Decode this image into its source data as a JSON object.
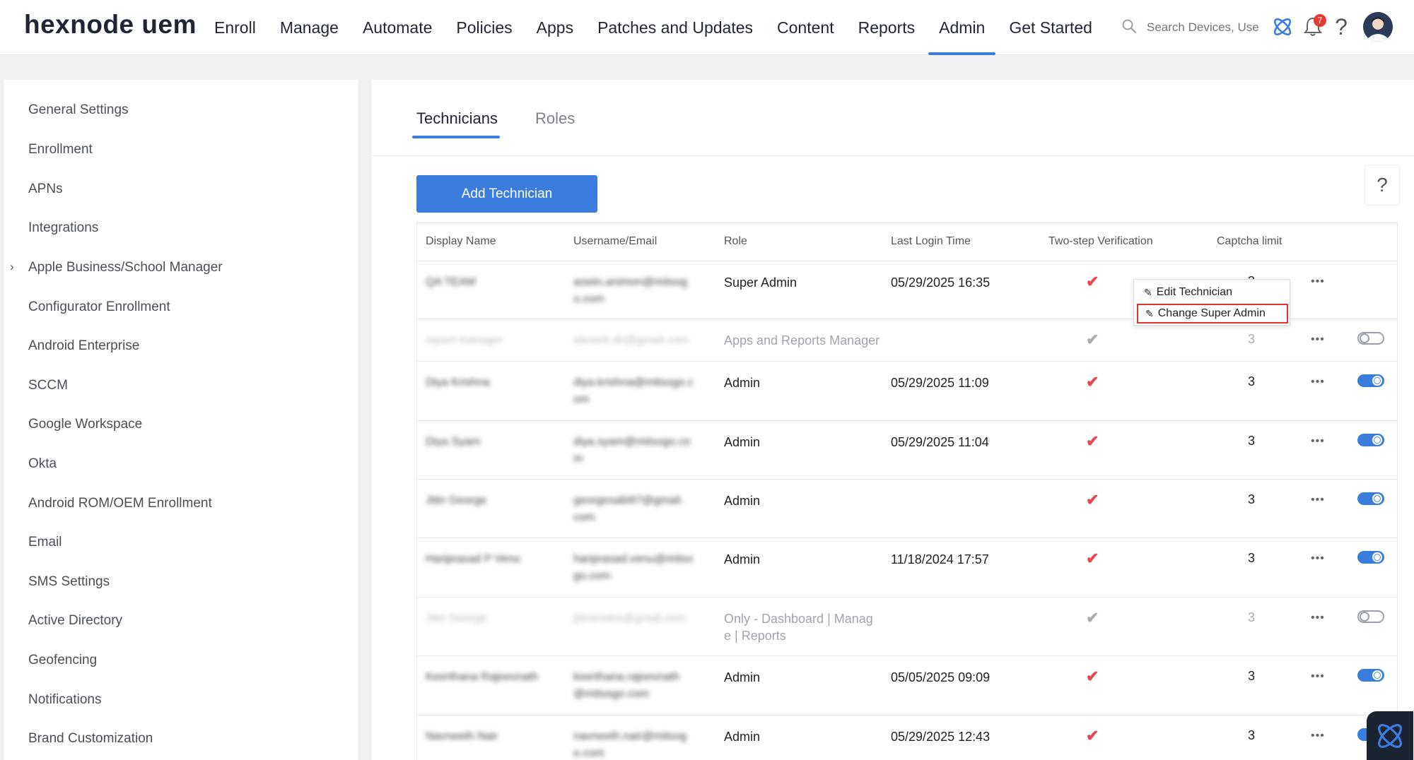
{
  "brand": {
    "logo_text": "hexnode uem",
    "accent": "#3b7ddd",
    "check_color": "#e5484d"
  },
  "nav": {
    "items": [
      {
        "label": "Enroll"
      },
      {
        "label": "Manage"
      },
      {
        "label": "Automate"
      },
      {
        "label": "Policies"
      },
      {
        "label": "Apps"
      },
      {
        "label": "Patches and Updates"
      },
      {
        "label": "Content"
      },
      {
        "label": "Reports"
      },
      {
        "label": "Admin"
      },
      {
        "label": "Get Started"
      }
    ],
    "active": "Admin"
  },
  "topbar": {
    "search_placeholder": "Search Devices, Use",
    "notification_count": "7",
    "help_icon": "?"
  },
  "sidebar": {
    "items": [
      {
        "label": "General Settings"
      },
      {
        "label": "Enrollment"
      },
      {
        "label": "APNs"
      },
      {
        "label": "Integrations"
      },
      {
        "label": "Apple Business/School Manager",
        "expandable": true
      },
      {
        "label": "Configurator Enrollment"
      },
      {
        "label": "Android Enterprise"
      },
      {
        "label": "SCCM"
      },
      {
        "label": "Google Workspace"
      },
      {
        "label": "Okta"
      },
      {
        "label": "Android ROM/OEM Enrollment"
      },
      {
        "label": "Email"
      },
      {
        "label": "SMS Settings"
      },
      {
        "label": "Active Directory"
      },
      {
        "label": "Geofencing"
      },
      {
        "label": "Notifications"
      },
      {
        "label": "Brand Customization"
      }
    ]
  },
  "main": {
    "tabs": [
      {
        "label": "Technicians"
      },
      {
        "label": "Roles"
      }
    ],
    "active_tab": "Technicians",
    "add_button": "Add Technician",
    "help_label": "?",
    "table": {
      "headers": [
        "Display Name",
        "Username/Email",
        "Role",
        "Last Login Time",
        "Two-step Verification",
        "Captcha limit"
      ],
      "rows": [
        {
          "name": "QA TEAM",
          "email": [
            "aswin.animon@mitsog",
            "o.com"
          ],
          "role": "Super Admin",
          "last_login": "05/29/2025 16:35",
          "two_step": true,
          "captcha": "3",
          "enabled": true,
          "has_toggle": false
        },
        {
          "name": "report manager",
          "email": [
            "alexerk.dn@gmail.com"
          ],
          "role": "Apps and Reports Manager",
          "last_login": "",
          "two_step": true,
          "captcha": "3",
          "enabled": false,
          "has_toggle": true
        },
        {
          "name": "Diya Krishna",
          "email": [
            "diya.krishna@mitsogo.c",
            "om"
          ],
          "role": "Admin",
          "last_login": "05/29/2025 11:09",
          "two_step": true,
          "captcha": "3",
          "enabled": true,
          "has_toggle": true
        },
        {
          "name": "Diya Syam",
          "email": [
            "diya.syam@mitsogo.co",
            "m"
          ],
          "role": "Admin",
          "last_login": "05/29/2025 11:04",
          "two_step": true,
          "captcha": "3",
          "enabled": true,
          "has_toggle": true
        },
        {
          "name": "Jitin George",
          "email": [
            "georgesabi97@gmail.",
            "com"
          ],
          "role": "Admin",
          "last_login": "",
          "two_step": true,
          "captcha": "3",
          "enabled": true,
          "has_toggle": true
        },
        {
          "name": "Hariprasad P Venu",
          "email": [
            "hariprasad.venu@mitso",
            "go.com"
          ],
          "role": "Admin",
          "last_login": "11/18/2024 17:57",
          "two_step": true,
          "captcha": "3",
          "enabled": true,
          "has_toggle": true
        },
        {
          "name": "Jitin George",
          "email": [
            "jitinsmiles@gmail.com"
          ],
          "role": [
            "Only - Dashboard | Manag",
            "e | Reports"
          ],
          "last_login": "",
          "two_step": true,
          "captcha": "3",
          "enabled": false,
          "has_toggle": true
        },
        {
          "name": "Keerthana Rajeevnath",
          "email": [
            "keerthana.rajeevnath",
            "@mitsogo.com"
          ],
          "role": "Admin",
          "last_login": "05/05/2025 09:09",
          "two_step": true,
          "captcha": "3",
          "enabled": true,
          "has_toggle": true
        },
        {
          "name": "Navneeth Nair",
          "email": [
            "navneeth.nair@mitsog",
            "o.com"
          ],
          "role": "Admin",
          "last_login": "05/29/2025 12:43",
          "two_step": true,
          "captcha": "3",
          "enabled": true,
          "has_toggle": true
        }
      ]
    },
    "context_menu": {
      "items": [
        {
          "label": "Edit Technician"
        },
        {
          "label": "Change Super Admin"
        }
      ],
      "highlighted": "Change Super Admin"
    }
  }
}
